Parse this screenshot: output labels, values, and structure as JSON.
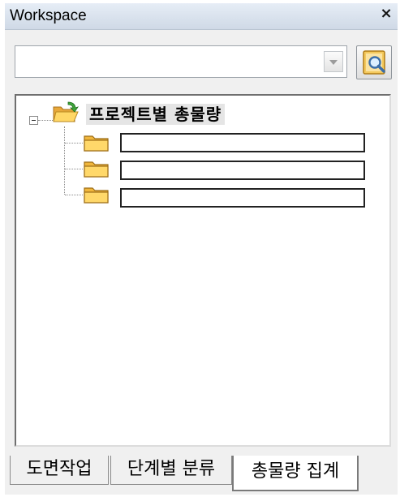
{
  "window": {
    "title": "Workspace",
    "close_glyph": "×"
  },
  "search": {
    "value": "",
    "dropdown_icon": "chevron-down-icon",
    "button_icon": "magnifier-icon"
  },
  "tree": {
    "root": {
      "label": "프로젝트별 총물량",
      "expanded": true,
      "icon": "folder-open-icon"
    },
    "children": [
      {
        "label": "",
        "icon": "folder-icon"
      },
      {
        "label": "",
        "icon": "folder-icon"
      },
      {
        "label": "",
        "icon": "folder-icon"
      }
    ]
  },
  "tabs": [
    {
      "label": "도면작업",
      "active": false
    },
    {
      "label": "단계별 분류",
      "active": false
    },
    {
      "label": "총물량 집계",
      "active": true
    }
  ]
}
